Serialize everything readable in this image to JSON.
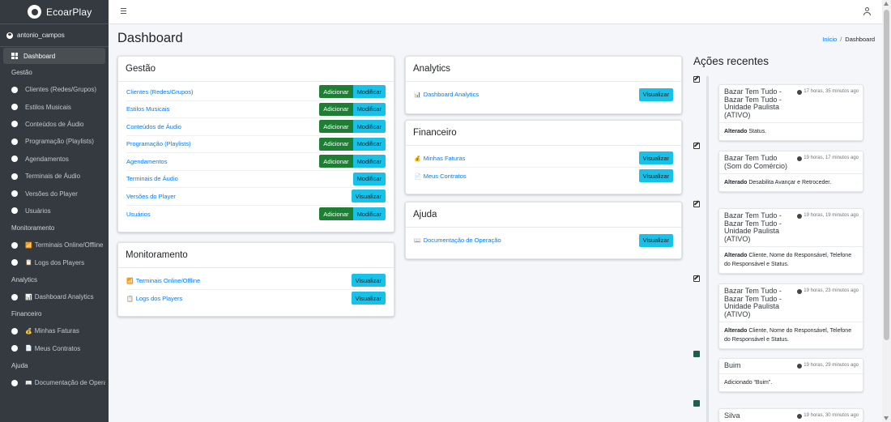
{
  "brand": {
    "name": "EcoarPlay"
  },
  "user": {
    "name": "antonio_campos"
  },
  "sidebar": {
    "dashboard": "Dashboard",
    "sections": [
      {
        "header": "Gestão",
        "items": [
          "Clientes (Redes/Grupos)",
          "Estilos Musicais",
          "Conteúdos de Áudio",
          "Programação (Playlists)",
          "Agendamentos",
          "Terminais de Áudio",
          "Versões do Player",
          "Usuários"
        ]
      },
      {
        "header": "Monitoramento",
        "items": [
          "Terminais Online/Offline",
          "Logs dos Players"
        ]
      },
      {
        "header": "Analytics",
        "items": [
          "Dashboard Analytics"
        ]
      },
      {
        "header": "Financeiro",
        "items": [
          "Minhas Faturas",
          "Meus Contratos"
        ]
      },
      {
        "header": "Ajuda",
        "items": [
          "Documentação de Operação"
        ]
      }
    ]
  },
  "page": {
    "title": "Dashboard"
  },
  "breadcrumb": {
    "home": "Início",
    "separator": "/",
    "current": "Dashboard"
  },
  "buttons": {
    "add": "Adicionar",
    "modify": "Modificar",
    "view": "Visualizar"
  },
  "gestao": {
    "title": "Gestão",
    "rows": [
      {
        "label": "Clientes (Redes/Grupos)"
      },
      {
        "label": "Estilos Musicais"
      },
      {
        "label": "Conteúdos de Áudio"
      },
      {
        "label": "Programação (Playlists)"
      },
      {
        "label": "Agendamentos"
      },
      {
        "label": "Terminais de Áudio"
      },
      {
        "label": "Versões do Player"
      },
      {
        "label": "Usuários"
      }
    ]
  },
  "monitoramento": {
    "title": "Monitoramento",
    "rows": [
      {
        "label": "Terminais Online/Offline"
      },
      {
        "label": "Logs dos Players"
      }
    ]
  },
  "analytics": {
    "title": "Analytics",
    "rows": [
      {
        "label": "Dashboard Analytics"
      }
    ]
  },
  "financeiro": {
    "title": "Financeiro",
    "rows": [
      {
        "label": "Minhas Faturas"
      },
      {
        "label": "Meus Contratos"
      }
    ]
  },
  "ajuda": {
    "title": "Ajuda",
    "rows": [
      {
        "label": "Documentação de Operação"
      }
    ]
  },
  "timeline": {
    "title": "Ações recentes",
    "items": [
      {
        "title": "Bazar Tem Tudo - Bazar Tem Tudo - Unidade Paulista (ATIVO)",
        "time": "17 horas, 35 minutos ago",
        "action": "Alterado",
        "detail": "Status."
      },
      {
        "title": "Bazar Tem Tudo (Som do Comércio)",
        "time": "19 horas, 17 minutos ago",
        "action": "Alterado",
        "detail": "Desabilita Avançar e Retroceder."
      },
      {
        "title": "Bazar Tem Tudo - Bazar Tem Tudo - Unidade Paulista (ATIVO)",
        "time": "19 horas, 19 minutos ago",
        "action": "Alterado",
        "detail": "Cliente, Nome do Responsável, Telefone do Responsável e Status."
      },
      {
        "title": "Bazar Tem Tudo - Bazar Tem Tudo - Unidade Paulista (ATIVO)",
        "time": "19 horas, 23 minutos ago",
        "action": "Alterado",
        "detail": "Cliente, Nome do Responsável, Telefone do Responsável e Status."
      },
      {
        "title": "Buim",
        "time": "19 horas, 29 minutos ago",
        "action": "",
        "detail": "Adicionado “Buim”."
      },
      {
        "title": "Silva",
        "time": "19 horas, 30 minutos ago",
        "action": "",
        "detail": ""
      }
    ]
  }
}
